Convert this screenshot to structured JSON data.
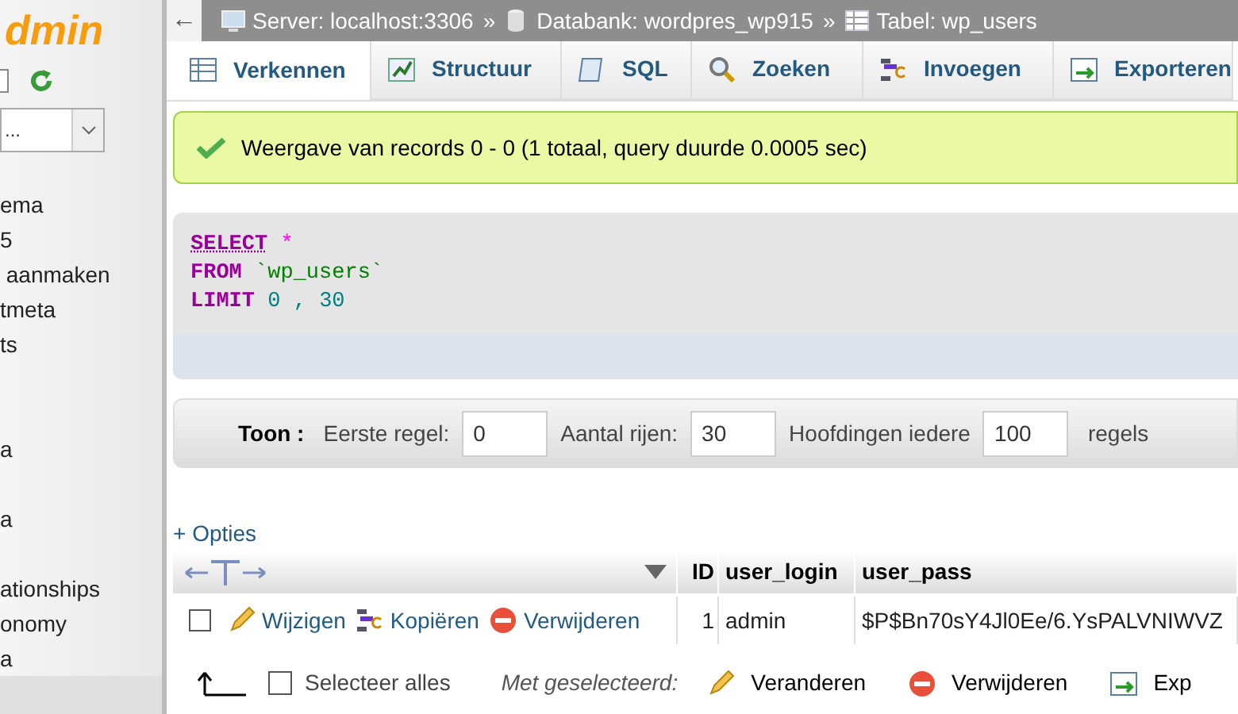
{
  "sidebar": {
    "logo": "dmin",
    "database_select": {
      "value": "..."
    },
    "groups": [
      [
        "ema",
        "5",
        " aanmaken",
        "tmeta",
        "ts"
      ],
      [
        "a"
      ],
      [
        "a"
      ],
      [
        "ationships",
        "onomy",
        "a"
      ]
    ]
  },
  "breadcrumb": [
    {
      "kind": "server",
      "label": "Server: localhost:3306"
    },
    {
      "kind": "database",
      "label": "Databank: wordpres_wp915"
    },
    {
      "kind": "table",
      "label": "Tabel: wp_users"
    }
  ],
  "separator": "»",
  "back_button": "←",
  "tabs": [
    {
      "label": "Verkennen",
      "kind": "browse",
      "selected": true
    },
    {
      "label": "Structuur",
      "kind": "structure",
      "selected": false
    },
    {
      "label": "SQL",
      "kind": "sql",
      "selected": false
    },
    {
      "label": "Zoeken",
      "kind": "search",
      "selected": false
    },
    {
      "label": "Invoegen",
      "kind": "insert",
      "selected": false
    },
    {
      "label": "Exporteren",
      "kind": "export",
      "selected": false
    }
  ],
  "message": "Weergave van records 0 - 0 (1 totaal, query duurde 0.0005 sec)",
  "sql_lines": [
    [
      {
        "text": "SELECT",
        "kind": "keyword"
      },
      {
        "text": "*",
        "kind": "operator"
      }
    ],
    [
      {
        "text": "FROM",
        "kind": "keyword"
      },
      {
        "text": "`wp_users`",
        "kind": "string"
      }
    ],
    [
      {
        "text": "LIMIT",
        "kind": "keyword"
      },
      {
        "text": "0",
        "kind": "number"
      },
      {
        "text": ",",
        "kind": "number"
      },
      {
        "text": "30",
        "kind": "number"
      }
    ]
  ],
  "show_bar": {
    "label": "Toon :",
    "fields": [
      {
        "label": "Eerste regel:",
        "value": "0"
      },
      {
        "label": "Aantal rijen:",
        "value": "30"
      },
      {
        "label": "Hoofdingen iedere",
        "value": "100"
      }
    ],
    "suffix": "regels"
  },
  "options_link": "+ Opties",
  "table": {
    "columns": [
      "ID",
      "user_login",
      "user_pass"
    ],
    "rows": [
      {
        "checked": false,
        "actions": [
          {
            "kind": "edit",
            "label": "Wijzigen"
          },
          {
            "kind": "copy",
            "label": "Kopiëren"
          },
          {
            "kind": "delete",
            "label": "Verwijderen"
          }
        ],
        "cells": [
          "1",
          "admin",
          "$P$Bn70sY4Jl0Ee/6.YsPALVNIWVZ"
        ]
      }
    ]
  },
  "bulk": {
    "select_all": {
      "label": "Selecteer alles",
      "checked": false
    },
    "with_selected": "Met geselecteerd:",
    "actions": [
      {
        "kind": "edit",
        "label": "Veranderen"
      },
      {
        "kind": "delete",
        "label": "Verwijderen"
      },
      {
        "kind": "export",
        "label": "Exp"
      }
    ]
  }
}
